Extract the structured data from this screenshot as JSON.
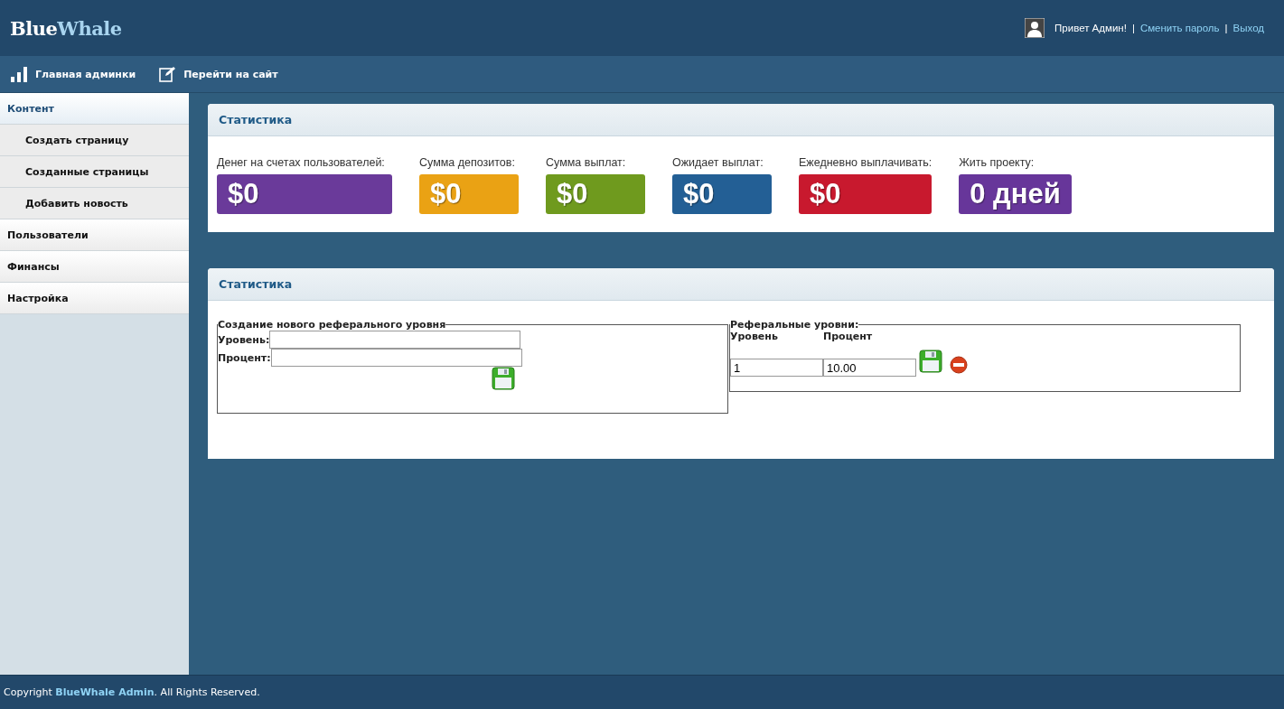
{
  "header": {
    "logo": {
      "first": "Blue",
      "second": "Whale"
    },
    "greeting": "Привет Админ!",
    "separator_1": "|",
    "change_password": "Сменить пароль",
    "separator_2": "|",
    "logout": "Выход"
  },
  "nav": [
    {
      "kind": "chart",
      "label": "Главная админки"
    },
    {
      "kind": "edit",
      "label": "Перейти на сайт"
    }
  ],
  "sidebar": {
    "items": [
      {
        "label": "Контент",
        "selected": true,
        "children": [
          {
            "label": "Создать страницу",
            "selected": false
          },
          {
            "label": "Созданные страницы",
            "selected": false
          },
          {
            "label": "Добавить новость",
            "selected": false
          }
        ]
      },
      {
        "label": "Пользователи",
        "selected": false
      },
      {
        "label": "Финансы",
        "selected": false
      },
      {
        "label": "Настройка",
        "selected": false
      }
    ]
  },
  "stats_panel": {
    "title": "Статистика",
    "stats": [
      {
        "label": "Денег на счетах пользователей:",
        "value": "$0",
        "color": "#6a3a9a"
      },
      {
        "label": "Сумма депозитов:",
        "value": "$0",
        "color": "#eaa214"
      },
      {
        "label": "Сумма выплат:",
        "value": "$0",
        "color": "#6f9a1e"
      },
      {
        "label": "Ожидает выплат:",
        "value": "$0",
        "color": "#235f95"
      },
      {
        "label": "Ежедневно выплачивать:",
        "value": "$0",
        "color": "#c8192e"
      },
      {
        "label": "Жить проекту:",
        "value": "0 дней",
        "color": "#67369a"
      }
    ]
  },
  "referral_panel": {
    "title": "Статистика",
    "new_level": {
      "legend": "Создание нового реферального уровня",
      "level_label": "Уровень:",
      "percent_label": "Процент:"
    },
    "levels": {
      "legend": "Реферальные уровни:",
      "column_1": "Уровень",
      "column_2": "Процент",
      "rows": [
        {
          "level": "1",
          "percent": "10.00"
        }
      ]
    }
  },
  "footer": {
    "prefix": "Copyright ",
    "link": "BlueWhale Admin",
    "suffix": ". All Rights Reserved."
  }
}
